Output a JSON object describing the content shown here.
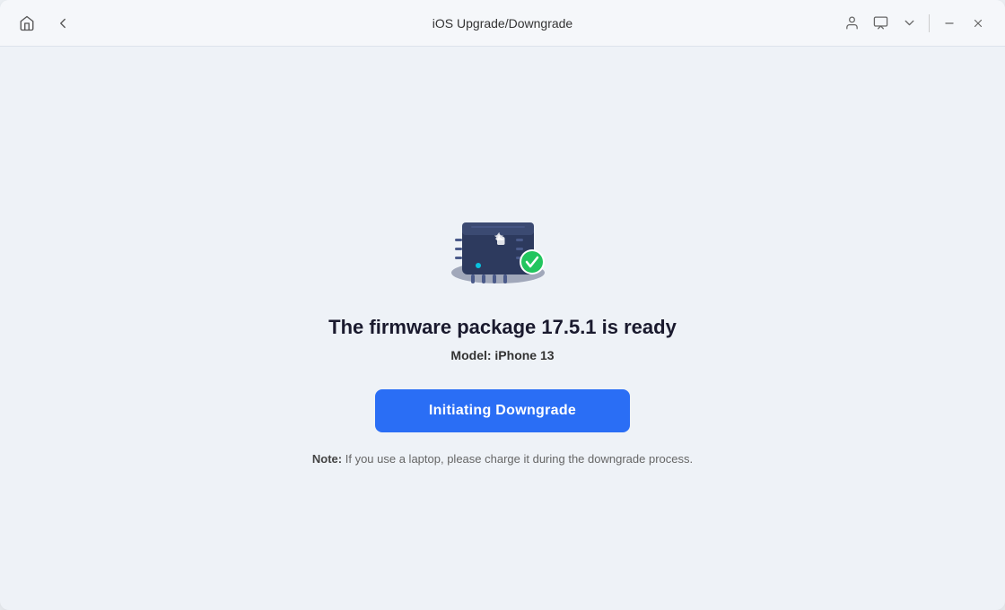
{
  "titlebar": {
    "title": "iOS Upgrade/Downgrade",
    "home_icon": "🏠",
    "back_icon": "←",
    "user_icon": "👤",
    "chat_icon": "💬",
    "chevron_icon": "∨",
    "minimize_icon": "—",
    "close_icon": "✕"
  },
  "main": {
    "firmware_title": "The firmware package 17.5.1 is ready",
    "model_label": "Model:",
    "model_value": "iPhone 13",
    "button_label": "Initiating Downgrade",
    "note_label": "Note:",
    "note_text": "  If you use a laptop, please charge it during the downgrade process."
  }
}
